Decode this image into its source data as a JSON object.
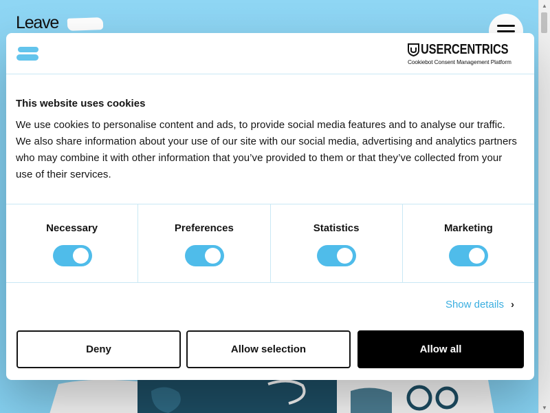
{
  "site": {
    "logo_text": "Leave",
    "menu_icon": "hamburger-icon"
  },
  "dialog": {
    "provider": {
      "name": "USERCENTRICS",
      "tagline": "Cookiebot Consent Management Platform"
    },
    "title": "This website uses cookies",
    "body": "We use cookies to personalise content and ads, to provide social media features and to analyse our traffic. We also share information about your use of our site with our social media, advertising and analytics partners who may combine it with other information that you’ve provided to them or that they’ve collected from your use of their services.",
    "categories": [
      {
        "label": "Necessary",
        "enabled": true
      },
      {
        "label": "Preferences",
        "enabled": true
      },
      {
        "label": "Statistics",
        "enabled": true
      },
      {
        "label": "Marketing",
        "enabled": true
      }
    ],
    "show_details": "Show details",
    "buttons": {
      "deny": "Deny",
      "allow_selection": "Allow selection",
      "allow_all": "Allow all"
    }
  },
  "colors": {
    "accent": "#4fbcea",
    "background": "#8fd3f0",
    "primary_button": "#000000"
  }
}
